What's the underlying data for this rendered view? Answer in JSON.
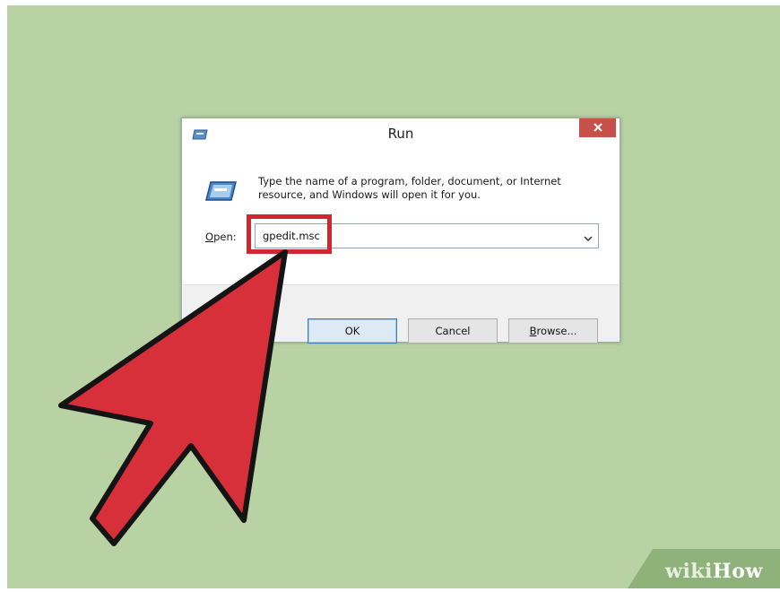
{
  "dialog": {
    "title": "Run",
    "close_label": "✕",
    "prompt": "Type the name of a program, folder, document, or Internet resource, and Windows will open it for you.",
    "open_label_accel": "O",
    "open_label_rest": "pen:",
    "open_value": "gpedit.msc",
    "buttons": {
      "ok": "OK",
      "cancel": "Cancel",
      "browse_accel": "B",
      "browse_rest": "rowse..."
    }
  },
  "watermark": {
    "wiki": "wiki",
    "how": "How"
  },
  "colors": {
    "background": "#b8d2a4",
    "highlight": "#d4262e",
    "arrow": "#d8303a",
    "close_button": "#c7504b"
  },
  "icons": {
    "title": "run-app-icon",
    "dialog": "run-app-icon",
    "close": "close-icon",
    "dropdown": "chevron-down-icon",
    "pointer": "red-arrow-pointer"
  }
}
